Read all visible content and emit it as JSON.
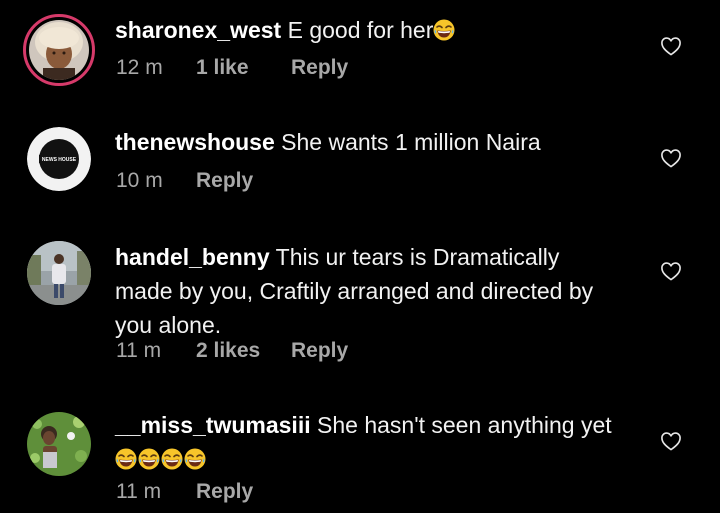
{
  "comments": [
    {
      "username": "sharonex_west",
      "text": "E good for her",
      "emoji_count": 1,
      "time": "12 m",
      "likes": "1 like",
      "reply": "Reply",
      "avatar": "woman-with-blonde-wig-avatar"
    },
    {
      "username": "thenewshouse",
      "text": "She wants 1 million Naira",
      "time": "10 m",
      "reply": "Reply",
      "avatar_logo_text": "NEWS HOUSE"
    },
    {
      "username": "handel_benny",
      "text_lines": [
        "This ur tears is Dramatically",
        "made by you, Craftily arranged and directed by",
        "you alone."
      ],
      "time": "11 m",
      "likes": "2 likes",
      "reply": "Reply",
      "avatar": "person-standing-outdoors-avatar"
    },
    {
      "username": "__miss_twumasiii",
      "text": "She hasn't seen anything yet",
      "emoji_count": 4,
      "time": "11 m",
      "reply": "Reply",
      "avatar": "woman-with-flowers-avatar"
    }
  ],
  "icons": {
    "like": "heart-outline-icon",
    "emoji": "grinning-squinting-tears-emoji"
  },
  "colors": {
    "background": "#000000",
    "story_ring": "#d63a6a",
    "meta_text": "#a8a8a8"
  }
}
